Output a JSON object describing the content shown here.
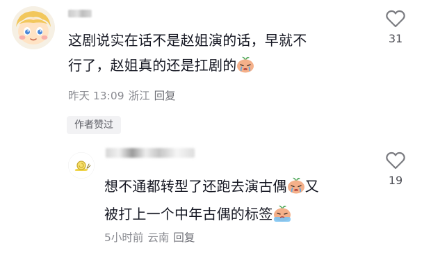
{
  "comments": [
    {
      "text_line1": "这剧说实在话不是赵姐演的话，早就不",
      "text_line2": "行了，赵姐真的还是扛剧的",
      "date": "昨天 13:09",
      "location": "浙江",
      "reply_label": "回复",
      "badge": "作者赞过",
      "likes": "31"
    },
    {
      "text_line1": "想不通都转型了还跑去演古偶",
      "text_line1_tail": "又",
      "text_line2": "被打上一个中年古偶的标签",
      "date": "5小时前",
      "location": "云南",
      "reply_label": "回复",
      "likes": "19"
    }
  ],
  "icons": {
    "comment1_emoji": "crying-face-emoji",
    "comment2_emoji_a": "crying-face-emoji",
    "comment2_emoji_b": "sweat-face-emoji",
    "like": "heart-outline-icon"
  },
  "colors": {
    "text": "#161823",
    "meta": "#8a8b91",
    "badge_bg": "#f2f2f4"
  }
}
